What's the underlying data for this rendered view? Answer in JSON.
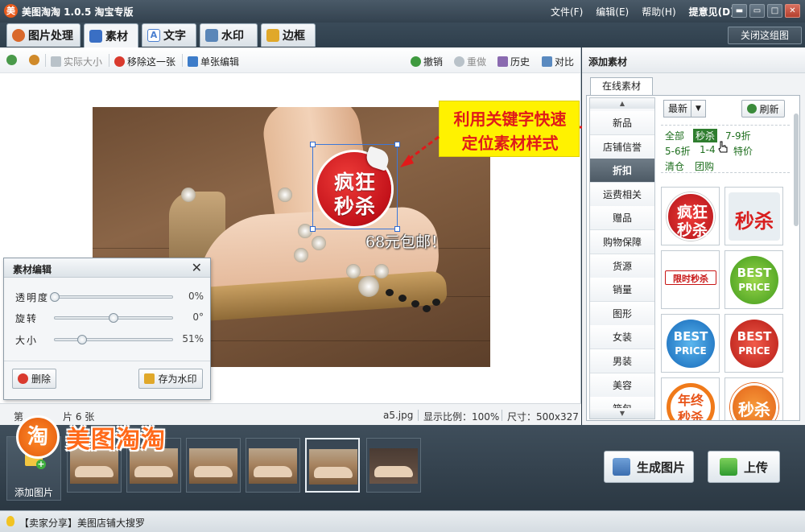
{
  "window": {
    "app_logo": "美",
    "title": "美图淘淘 1.0.5 淘宝专版",
    "menus": [
      "文件(F)",
      "编辑(E)",
      "帮助(H)",
      "提意见(D)"
    ],
    "controls": [
      "▬",
      "▭",
      "□",
      "✕"
    ]
  },
  "tabs": [
    {
      "label": "图片处理",
      "icon": "palette-icon",
      "color": "#d9692c"
    },
    {
      "label": "素材",
      "icon": "material-icon",
      "color": "#3a6fc4"
    },
    {
      "label": "文字",
      "icon": "text-icon",
      "color": "#4a7fd0"
    },
    {
      "label": "水印",
      "icon": "watermark-icon",
      "color": "#5a86b8"
    },
    {
      "label": "边框",
      "icon": "frame-icon",
      "color": "#e0a82a"
    }
  ],
  "close_group": "关闭这组图",
  "toolbar": {
    "actual_size": "实际大小",
    "remove_one": "移除这一张",
    "single_edit": "单张编辑",
    "undo": "撤销",
    "redo": "重做",
    "history": "历史",
    "compare": "对比"
  },
  "canvas": {
    "sticker_line1": "疯狂",
    "sticker_line2": "秒杀",
    "watermark_text": "68元包邮！"
  },
  "callout": {
    "line1": "利用关键字快速",
    "line2": "定位素材样式"
  },
  "dialog": {
    "title": "素材编辑",
    "close": "✕",
    "sliders": [
      {
        "label": "透明度",
        "value": "0%",
        "level": 0.0
      },
      {
        "label": "旋转",
        "value": "0°",
        "level": 0.5
      },
      {
        "label": "大小",
        "value": "51%",
        "level": 0.23
      }
    ],
    "delete": "删除",
    "save_watermark": "存为水印"
  },
  "status": {
    "count_prefix": "第",
    "count_suffix": "片 6 张",
    "filename": "a5.jpg",
    "ratio": "显示比例：100%",
    "size": "尺寸：500x327"
  },
  "right_panel": {
    "title": "添加素材",
    "online_tab": "在线素材",
    "categories": [
      "新品",
      "店铺信誉",
      "折扣",
      "运费相关",
      "赠品",
      "购物保障",
      "货源",
      "销量",
      "图形",
      "女装",
      "男装",
      "美容",
      "箱包"
    ],
    "selected_category": "折扣",
    "sort_value": "最新",
    "refresh": "刷新",
    "filters_row1": [
      "全部",
      "秒杀",
      "7-9折"
    ],
    "filters_row2": [
      "5-6折",
      "1-4",
      "特价"
    ],
    "filters_row3": [
      "清仓",
      "团购"
    ],
    "selected_filter": "秒杀",
    "stickers": [
      {
        "name": "crazy-flash-sale-sticker",
        "line1": "疯狂",
        "line2": "秒杀"
      },
      {
        "name": "flash-sale-sticker",
        "line1": "秒杀"
      },
      {
        "name": "limited-time-sticker",
        "line1": "限时秒杀"
      },
      {
        "name": "best-price-green-sticker",
        "line1": "BEST",
        "line2": "PRICE"
      },
      {
        "name": "best-price-blue-sticker",
        "line1": "BEST",
        "line2": "PRICE"
      },
      {
        "name": "best-price-red-sticker",
        "line1": "BEST",
        "line2": "PRICE"
      },
      {
        "name": "year-end-sale-sticker",
        "line1": "年终",
        "line2": "秒杀"
      },
      {
        "name": "flash-sale-orange-sticker",
        "line1": "秒杀"
      }
    ]
  },
  "bottom": {
    "brand_logo": "淘",
    "brand_text": "美图淘淘",
    "add_image": "添加图片",
    "generate": "生成图片",
    "upload": "上传"
  },
  "statusbar": {
    "text": "【卖家分享】美图店铺大搜罗"
  }
}
